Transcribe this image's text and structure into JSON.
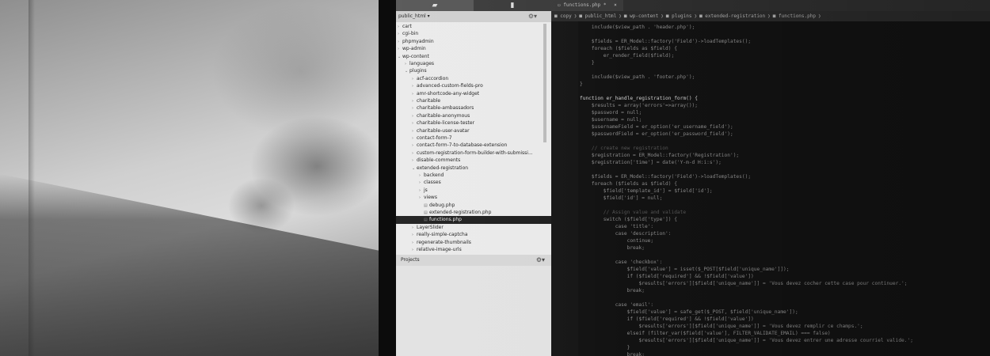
{
  "sidebar": {
    "project_root": "public_html",
    "tree": [
      {
        "label": "cart",
        "depth": 0,
        "type": "folder"
      },
      {
        "label": "cgi-bin",
        "depth": 0,
        "type": "folder"
      },
      {
        "label": "phpmyadmin",
        "depth": 0,
        "type": "folder"
      },
      {
        "label": "wp-admin",
        "depth": 0,
        "type": "folder"
      },
      {
        "label": "wp-content",
        "depth": 0,
        "type": "folder-open"
      },
      {
        "label": "languages",
        "depth": 1,
        "type": "folder"
      },
      {
        "label": "plugins",
        "depth": 1,
        "type": "folder-open"
      },
      {
        "label": "acf-accordion",
        "depth": 2,
        "type": "folder"
      },
      {
        "label": "advanced-custom-fields-pro",
        "depth": 2,
        "type": "folder"
      },
      {
        "label": "amr-shortcode-any-widget",
        "depth": 2,
        "type": "folder"
      },
      {
        "label": "charitable",
        "depth": 2,
        "type": "folder"
      },
      {
        "label": "charitable-ambassadors",
        "depth": 2,
        "type": "folder"
      },
      {
        "label": "charitable-anonymous",
        "depth": 2,
        "type": "folder"
      },
      {
        "label": "charitable-license-tester",
        "depth": 2,
        "type": "folder"
      },
      {
        "label": "charitable-user-avatar",
        "depth": 2,
        "type": "folder"
      },
      {
        "label": "contact-form-7",
        "depth": 2,
        "type": "folder"
      },
      {
        "label": "contact-form-7-to-database-extension",
        "depth": 2,
        "type": "folder"
      },
      {
        "label": "custom-registration-form-builder-with-submissi...",
        "depth": 2,
        "type": "folder"
      },
      {
        "label": "disable-comments",
        "depth": 2,
        "type": "folder"
      },
      {
        "label": "extended-registration",
        "depth": 2,
        "type": "folder-open"
      },
      {
        "label": "backend",
        "depth": 3,
        "type": "folder"
      },
      {
        "label": "classes",
        "depth": 3,
        "type": "folder"
      },
      {
        "label": "js",
        "depth": 3,
        "type": "folder"
      },
      {
        "label": "views",
        "depth": 3,
        "type": "folder"
      },
      {
        "label": "debug.php",
        "depth": 3,
        "type": "file"
      },
      {
        "label": "extended-registration.php",
        "depth": 3,
        "type": "file"
      },
      {
        "label": "functions.php",
        "depth": 3,
        "type": "file",
        "selected": true
      },
      {
        "label": "LayerSlider",
        "depth": 2,
        "type": "folder"
      },
      {
        "label": "really-simple-captcha",
        "depth": 2,
        "type": "folder"
      },
      {
        "label": "regenerate-thumbnails",
        "depth": 2,
        "type": "folder"
      },
      {
        "label": "relative-image-urls",
        "depth": 2,
        "type": "folder"
      }
    ],
    "projects_label": "Projects"
  },
  "editor": {
    "tab_label": "functions.php",
    "tab_modified": "*",
    "close_glyph": "×",
    "breadcrumb": [
      "copy",
      "public_html",
      "wp-content",
      "plugins",
      "extended-registration",
      "functions.php"
    ],
    "lines": [
      {
        "n": "",
        "t": "    include($view_path . 'header.php');"
      },
      {
        "n": "",
        "t": ""
      },
      {
        "n": "",
        "t": "    $fields = ER_Model::factory('Field')->loadTemplates();"
      },
      {
        "n": "",
        "t": "    foreach ($fields as $field) {"
      },
      {
        "n": "",
        "t": "        er_render_field($field);"
      },
      {
        "n": "",
        "t": "    }"
      },
      {
        "n": "",
        "t": ""
      },
      {
        "n": "",
        "t": "    include($view_path . 'footer.php');"
      },
      {
        "n": "",
        "t": "}"
      },
      {
        "n": "",
        "t": ""
      },
      {
        "n": "",
        "t": "function er_handle_registration_form() {"
      },
      {
        "n": "",
        "t": "    $results = array('errors'=>array());"
      },
      {
        "n": "",
        "t": "    $password = null;"
      },
      {
        "n": "",
        "t": "    $username = null;"
      },
      {
        "n": "",
        "t": "    $usernameField = er_option('er_username_field');"
      },
      {
        "n": "",
        "t": "    $passwordField = er_option('er_password_field');"
      },
      {
        "n": "",
        "t": ""
      },
      {
        "n": "",
        "t": "    // create new registration"
      },
      {
        "n": "",
        "t": "    $registration = ER_Model::factory('Registration');"
      },
      {
        "n": "",
        "t": "    $registration['time'] = date('Y-m-d H:i:s');"
      },
      {
        "n": "",
        "t": ""
      },
      {
        "n": "",
        "t": "    $fields = ER_Model::factory('Field')->loadTemplates();"
      },
      {
        "n": "",
        "t": "    foreach ($fields as $field) {"
      },
      {
        "n": "",
        "t": "        $field['template_id'] = $field['id'];"
      },
      {
        "n": "",
        "t": "        $field['id'] = null;"
      },
      {
        "n": "",
        "t": ""
      },
      {
        "n": "",
        "t": "        // Assign value and validate"
      },
      {
        "n": "",
        "t": "        switch ($field['type']) {"
      },
      {
        "n": "",
        "t": "            case 'title':"
      },
      {
        "n": "",
        "t": "            case 'description':"
      },
      {
        "n": "",
        "t": "                continue;"
      },
      {
        "n": "",
        "t": "                break;"
      },
      {
        "n": "",
        "t": ""
      },
      {
        "n": "",
        "t": "            case 'checkbox':"
      },
      {
        "n": "",
        "t": "                $field['value'] = isset($_POST[$field['unique_name']]);"
      },
      {
        "n": "",
        "t": "                if ($field['required'] && !$field['value'])"
      },
      {
        "n": "",
        "t": "                    $results['errors'][$field['unique_name']] = 'Vous devez cocher cette case pour continuer.';"
      },
      {
        "n": "",
        "t": "                break;"
      },
      {
        "n": "",
        "t": ""
      },
      {
        "n": "",
        "t": "            case 'email':"
      },
      {
        "n": "",
        "t": "                $field['value'] = safe_get($_POST, $field['unique_name']);"
      },
      {
        "n": "",
        "t": "                if ($field['required'] && !$field['value'])"
      },
      {
        "n": "",
        "t": "                    $results['errors'][$field['unique_name']] = 'Vous devez remplir ce champs.';"
      },
      {
        "n": "",
        "t": "                elseif (filter_var($field['value'], FILTER_VALIDATE_EMAIL) === false)"
      },
      {
        "n": "",
        "t": "                    $results['errors'][$field['unique_name']] = 'Vous devez entrer une adresse courriel valide.';"
      },
      {
        "n": "",
        "t": "                }"
      },
      {
        "n": "",
        "t": "                break;"
      }
    ]
  }
}
